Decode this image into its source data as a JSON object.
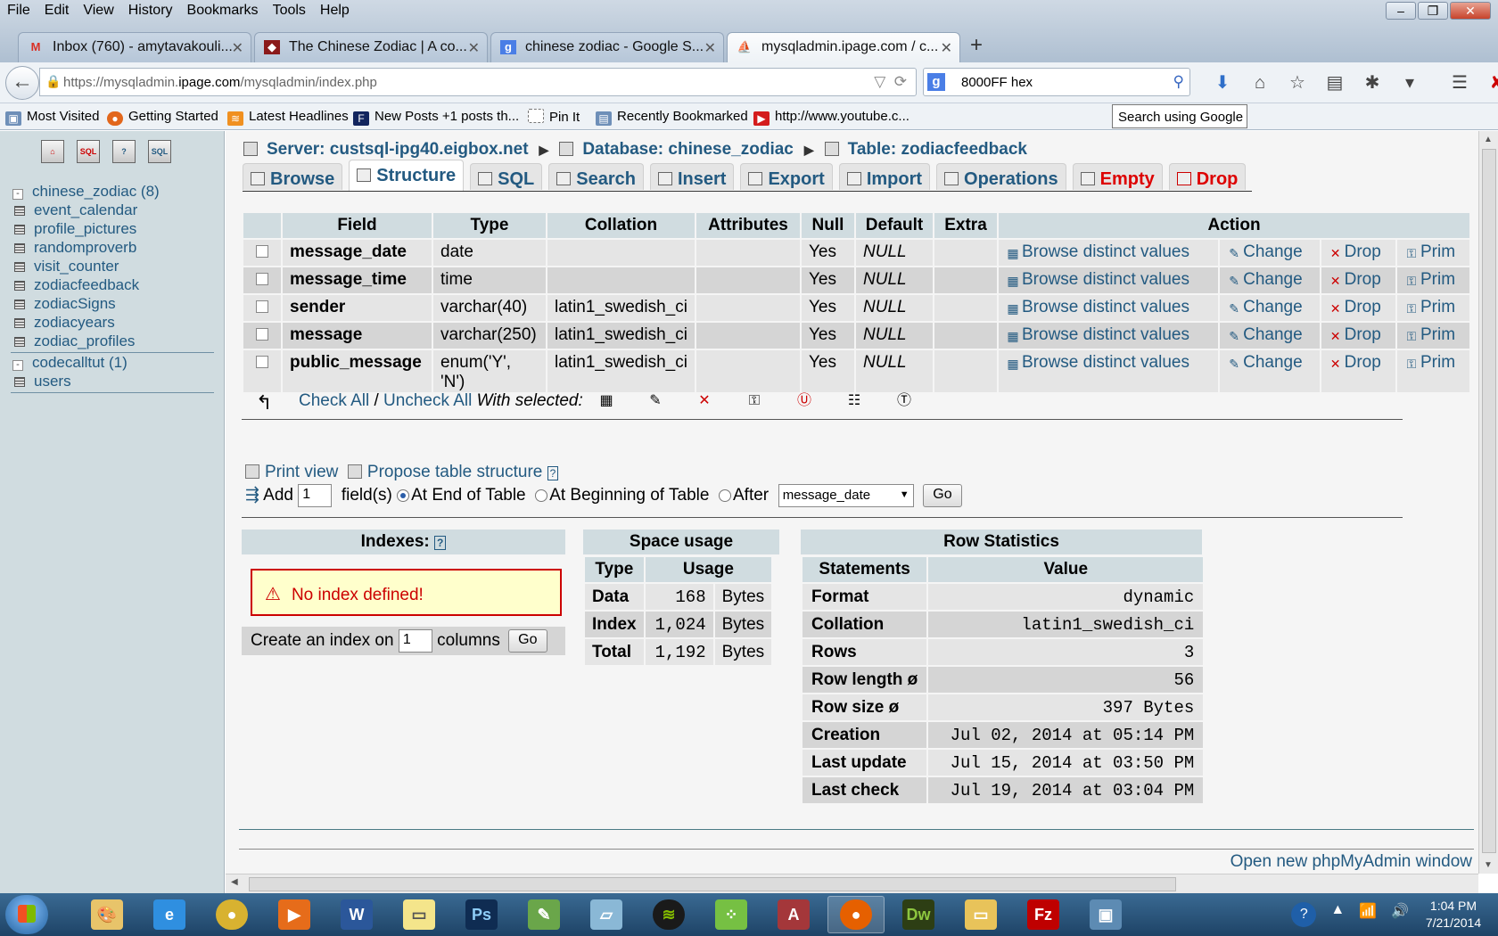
{
  "browser": {
    "menu": [
      "File",
      "Edit",
      "View",
      "History",
      "Bookmarks",
      "Tools",
      "Help"
    ],
    "tabs": [
      {
        "label": "Inbox (760) - amytavakouli...",
        "icon": "gmail-icon"
      },
      {
        "label": "The Chinese Zodiac | A co...",
        "icon": "site-favicon"
      },
      {
        "label": "chinese zodiac - Google S...",
        "icon": "google-icon"
      },
      {
        "label": "mysqladmin.ipage.com / c...",
        "icon": "phpmyadmin-icon"
      }
    ],
    "url_prefix": "https://mysqladmin.",
    "url_domain": "ipage.com",
    "url_path": "/mysqladmin/index.php",
    "search_value": "8000FF hex",
    "search_tooltip": "Search using Google",
    "bookmarks": [
      "Most Visited",
      "Getting Started",
      "Latest Headlines",
      "New Posts +1 posts th...",
      "Pin It",
      "Recently Bookmarked",
      "http://www.youtube.c..."
    ]
  },
  "sidebar": {
    "databases": [
      {
        "name": "chinese_zodiac (8)",
        "tables": [
          "event_calendar",
          "profile_pictures",
          "randomproverb",
          "visit_counter",
          "zodiacfeedback",
          "zodiacSigns",
          "zodiacyears",
          "zodiac_profiles"
        ]
      },
      {
        "name": "codecalltut (1)",
        "tables": [
          "users"
        ]
      }
    ]
  },
  "breadcrumb": {
    "server": "Server: custsql-ipg40.eigbox.net",
    "database": "Database: chinese_zodiac",
    "table": "Table: zodiacfeedback"
  },
  "tabs": [
    "Browse",
    "Structure",
    "SQL",
    "Search",
    "Insert",
    "Export",
    "Import",
    "Operations",
    "Empty",
    "Drop"
  ],
  "structure": {
    "headers": [
      "Field",
      "Type",
      "Collation",
      "Attributes",
      "Null",
      "Default",
      "Extra",
      "Action"
    ],
    "rows": [
      {
        "field": "message_date",
        "type": "date",
        "collation": "",
        "attributes": "",
        "null": "Yes",
        "default": "NULL",
        "extra": ""
      },
      {
        "field": "message_time",
        "type": "time",
        "collation": "",
        "attributes": "",
        "null": "Yes",
        "default": "NULL",
        "extra": ""
      },
      {
        "field": "sender",
        "type": "varchar(40)",
        "collation": "latin1_swedish_ci",
        "attributes": "",
        "null": "Yes",
        "default": "NULL",
        "extra": ""
      },
      {
        "field": "message",
        "type": "varchar(250)",
        "collation": "latin1_swedish_ci",
        "attributes": "",
        "null": "Yes",
        "default": "NULL",
        "extra": ""
      },
      {
        "field": "public_message",
        "type": "enum('Y',",
        "type2": "'N')",
        "collation": "latin1_swedish_ci",
        "attributes": "",
        "null": "Yes",
        "default": "NULL",
        "extra": ""
      }
    ],
    "actions": [
      "Browse distinct values",
      "Change",
      "Drop",
      "Prim"
    ],
    "check_all": "Check All",
    "slash": "/",
    "uncheck_all": "Uncheck All",
    "with_selected": "With selected:"
  },
  "tools": {
    "print_view": "Print view",
    "propose": "Propose table structure",
    "add_label": "Add",
    "add_count": "1",
    "fields_label": "field(s)",
    "at_end": "At End of Table",
    "at_beginning": "At Beginning of Table",
    "after": "After",
    "after_field": "message_date",
    "go": "Go"
  },
  "indexes": {
    "title": "Indexes:",
    "message": "No index defined!",
    "create_prefix": "Create an index on",
    "create_count": "1",
    "create_suffix": "columns",
    "go": "Go"
  },
  "space_usage": {
    "title": "Space usage",
    "headers": [
      "Type",
      "Usage"
    ],
    "rows": [
      {
        "type": "Data",
        "value": "168",
        "unit": "Bytes"
      },
      {
        "type": "Index",
        "value": "1,024",
        "unit": "Bytes"
      },
      {
        "type": "Total",
        "value": "1,192",
        "unit": "Bytes"
      }
    ]
  },
  "row_statistics": {
    "title": "Row Statistics",
    "headers": [
      "Statements",
      "Value"
    ],
    "rows": [
      {
        "k": "Format",
        "v": "dynamic"
      },
      {
        "k": "Collation",
        "v": "latin1_swedish_ci"
      },
      {
        "k": "Rows",
        "v": "3"
      },
      {
        "k": "Row length ø",
        "v": "56"
      },
      {
        "k": "Row size ø",
        "v": "397 Bytes"
      },
      {
        "k": "Creation",
        "v": "Jul 02, 2014 at 05:14 PM"
      },
      {
        "k": "Last update",
        "v": "Jul 15, 2014 at 03:50 PM"
      },
      {
        "k": "Last check",
        "v": "Jul 19, 2014 at 03:04 PM"
      }
    ]
  },
  "footer_link": "Open new phpMyAdmin window",
  "taskbar": {
    "apps": [
      "paint-icon",
      "internet-explorer-icon",
      "chrome-icon",
      "media-player-icon",
      "word-icon",
      "sticky-notes-icon",
      "photoshop-icon",
      "tool-icon",
      "notes-icon",
      "spotify-icon",
      "game-icon",
      "access-icon",
      "firefox-icon",
      "dreamweaver-icon",
      "explorer-icon",
      "filezilla-icon",
      "screen-icon"
    ],
    "time": "1:04 PM",
    "date": "7/21/2014"
  },
  "colors": {
    "link": "#235a81",
    "header_bg": "#d0dce0",
    "warning": "#cc0000"
  }
}
